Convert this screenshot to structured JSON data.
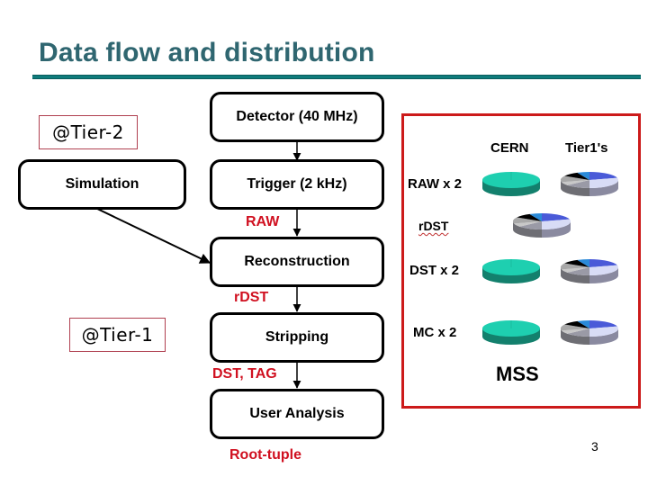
{
  "slide": {
    "title": "Data flow and distribution",
    "page_number": "3"
  },
  "tiers": {
    "tier2": "@Tier-2",
    "tier1": "@Tier-1"
  },
  "flow": {
    "detector": "Detector (40 MHz)",
    "trigger": "Trigger (2 kHz)",
    "simulation": "Simulation",
    "reconstruction": "Reconstruction",
    "stripping": "Stripping",
    "user_analysis": "User Analysis"
  },
  "flow_labels": {
    "raw": "RAW",
    "rdst": "rDST",
    "dst_tag": "DST, TAG",
    "root_tuple": "Root-tuple"
  },
  "storage": {
    "columns": [
      "CERN",
      "Tier1's"
    ],
    "rows": [
      {
        "label": "RAW x 2",
        "cern": true,
        "tier1": true
      },
      {
        "label": "rDST",
        "cern": false,
        "tier1": true
      },
      {
        "label": "DST x 2",
        "cern": true,
        "tier1": true
      },
      {
        "label": "MC x 2",
        "cern": true,
        "tier1": true
      }
    ],
    "footer": "MSS"
  },
  "colors": {
    "title": "#2f6670",
    "rule": "#0f7b7b",
    "flow_label_red": "#d01020",
    "mss_border": "#cc1a1a",
    "cern_pie": "#1ecfb0",
    "tier1_pie_slices": [
      "#4a5ad8",
      "#d8dcf6",
      "#9a9aa6",
      "#c8c8c8",
      "#a8a8a8",
      "#000000",
      "#2a8ad8"
    ]
  }
}
